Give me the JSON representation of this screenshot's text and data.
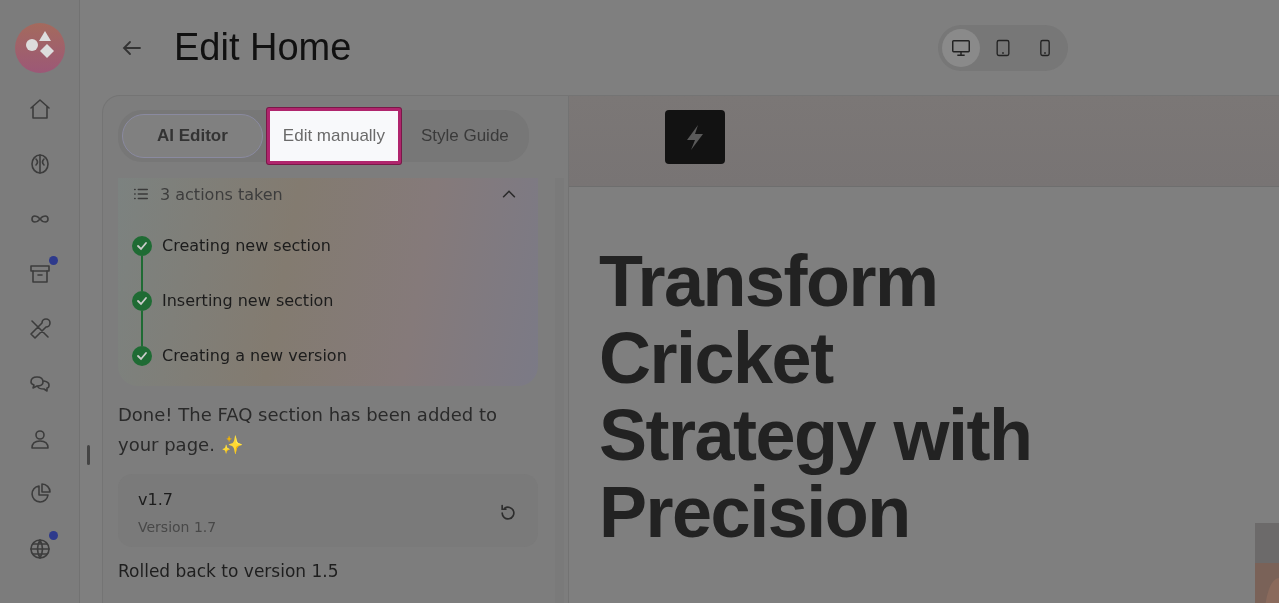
{
  "sidebar": {
    "items": [
      {
        "kind": "home",
        "badge": false
      },
      {
        "kind": "brain",
        "badge": false
      },
      {
        "kind": "infinity",
        "badge": false
      },
      {
        "kind": "archive",
        "badge": true
      },
      {
        "kind": "tools",
        "badge": false
      },
      {
        "kind": "chat",
        "badge": false
      },
      {
        "kind": "user",
        "badge": false
      },
      {
        "kind": "chart",
        "badge": false
      },
      {
        "kind": "globe",
        "badge": true
      }
    ]
  },
  "header": {
    "title": "Edit Home"
  },
  "devices": [
    {
      "kind": "desktop",
      "selected": true
    },
    {
      "kind": "tablet",
      "selected": false
    },
    {
      "kind": "phone",
      "selected": false
    }
  ],
  "tabs": [
    {
      "label": "AI Editor",
      "selected": true,
      "highlighted": false
    },
    {
      "label": "Edit manually",
      "selected": false,
      "highlighted": true
    },
    {
      "label": "Style Guide",
      "selected": false,
      "highlighted": false
    }
  ],
  "actions": {
    "summary": "3 actions taken",
    "expanded": true,
    "steps": [
      {
        "label": "Creating new section",
        "done": true
      },
      {
        "label": "Inserting new section",
        "done": true
      },
      {
        "label": "Creating a new version",
        "done": true
      }
    ]
  },
  "message": "Done! The FAQ section has been added to your page. ✨",
  "version": {
    "name": "v1.7",
    "description": "Version 1.7"
  },
  "message_2": "Rolled back to version 1.5",
  "preview": {
    "heading_lines": [
      "Transform",
      "Cricket",
      "Strategy with",
      "Precision"
    ]
  }
}
